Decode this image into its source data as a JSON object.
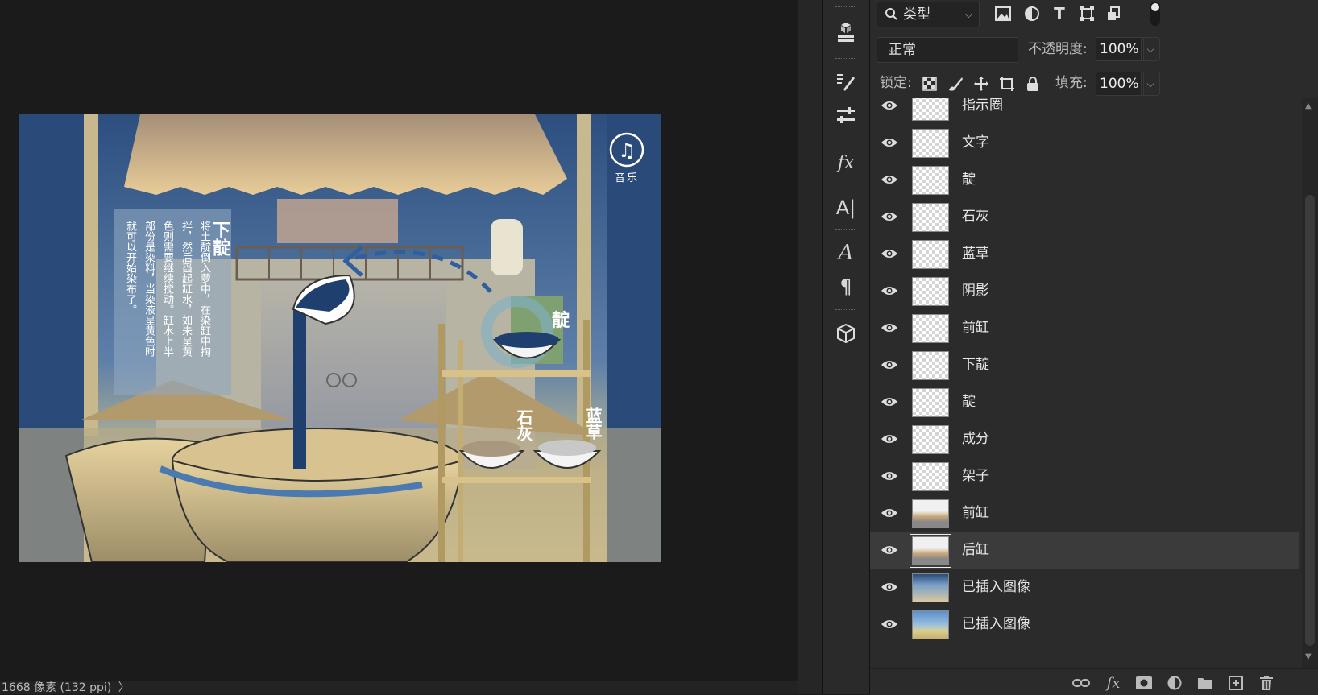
{
  "status_bar": {
    "text": "1668 像素 (132 ppi)",
    "arrow": "〉"
  },
  "artwork": {
    "music_label": "音乐",
    "vertical_title": "下靛",
    "vertical_columns": [
      "将土靛倒入萝中，在染缸中掏",
      "拌，然后舀起缸水，如未呈黄",
      "色则需要继续搅动。缸水上半",
      "部份是染料，当染液呈黄色时",
      "就可以开始染布了。"
    ],
    "label_dian": "靛",
    "label_shihui": "石灰",
    "label_lancao": "蓝草"
  },
  "layers_panel": {
    "filter_kind": "类型",
    "blend_mode": "正常",
    "opacity_label": "不透明度:",
    "opacity_value": "100%",
    "lock_label": "锁定:",
    "fill_label": "填充:",
    "fill_value": "100%",
    "layers": [
      {
        "name": "指示圈"
      },
      {
        "name": "文字"
      },
      {
        "name": "靛"
      },
      {
        "name": "石灰"
      },
      {
        "name": "蓝草"
      },
      {
        "name": "阴影"
      },
      {
        "name": "前缸"
      },
      {
        "name": "下靛"
      },
      {
        "name": "靛"
      },
      {
        "name": "成分"
      },
      {
        "name": "架子"
      },
      {
        "name": "前缸"
      },
      {
        "name": "后缸",
        "selected": true
      },
      {
        "name": "已插入图像"
      },
      {
        "name": "已插入图像"
      }
    ]
  },
  "colors": {
    "panel_bg": "#2b2b2b",
    "selected_row": "#3b3b3b",
    "canvas_bg": "#1b1b1b",
    "art_blue": "#2f4f7e",
    "art_cream": "#e8d4a0"
  }
}
